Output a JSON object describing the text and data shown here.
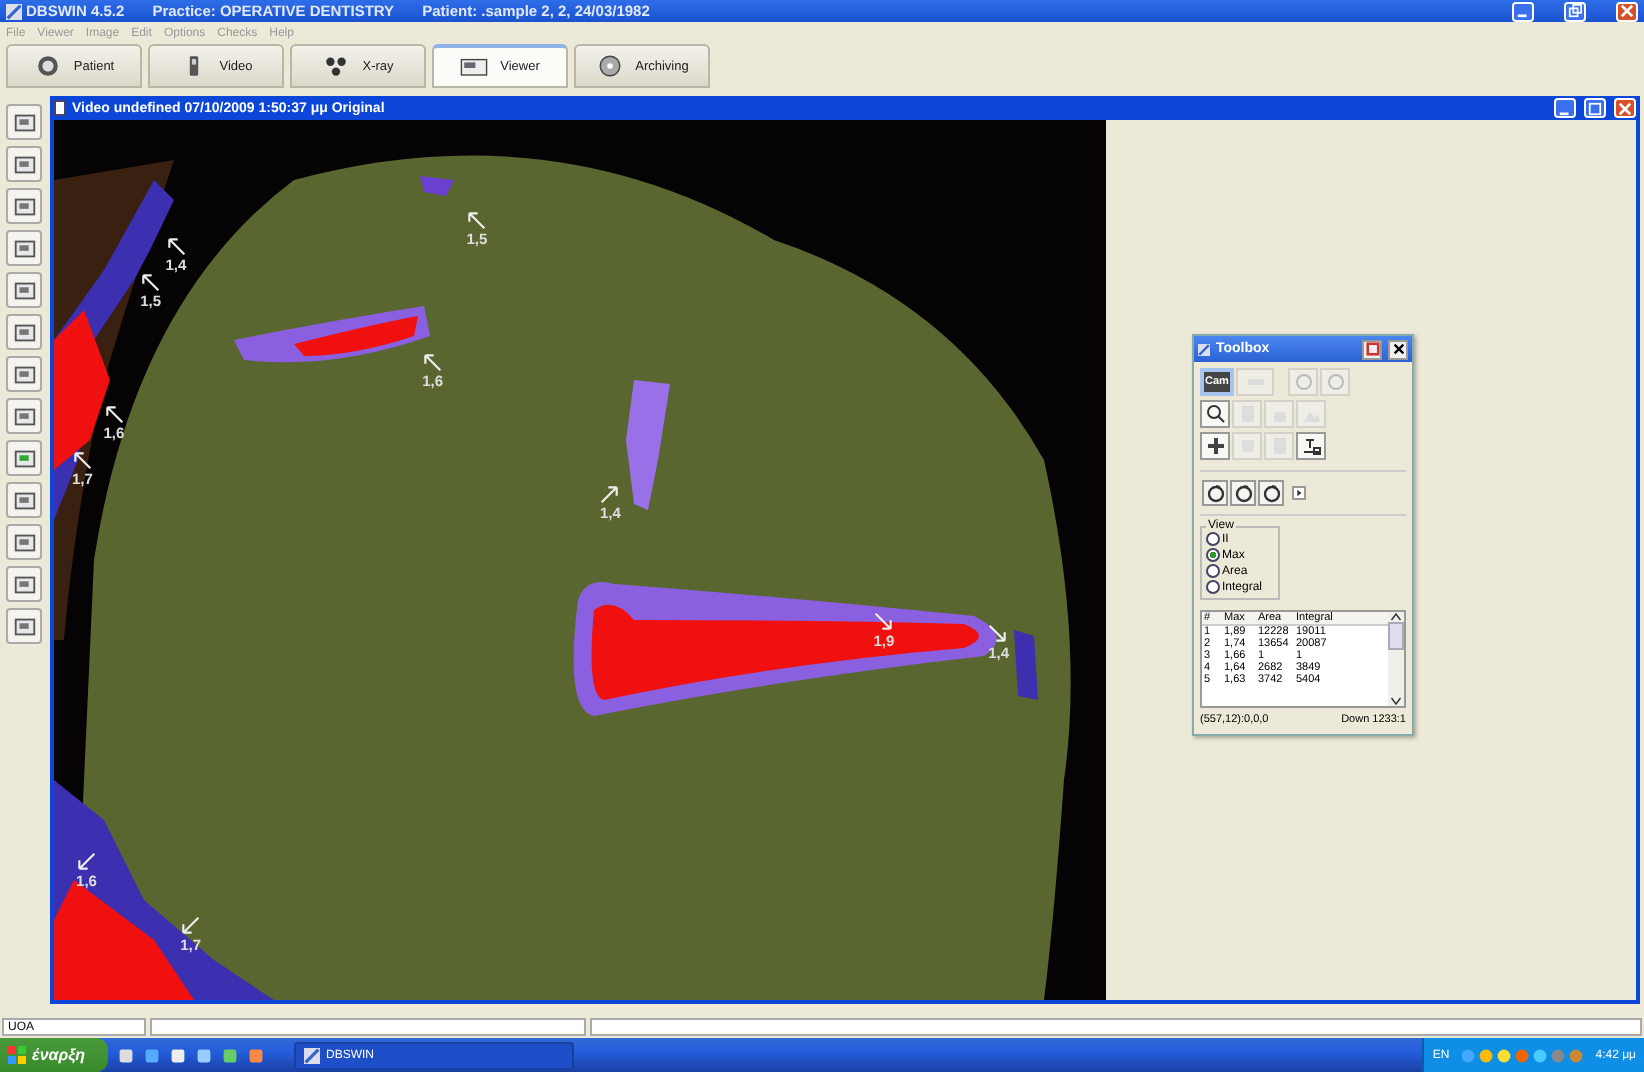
{
  "window": {
    "app": "DBSWIN 4.5.2",
    "practice": "Practice: OPERATIVE DENTISTRY",
    "patient": "Patient: .sample 2, 2, 24/03/1982"
  },
  "menu": [
    "File",
    "Viewer",
    "Image",
    "Edit",
    "Options",
    "Checks",
    "Help"
  ],
  "tabs": [
    {
      "label": "Patient",
      "kind": "patient",
      "selected": false
    },
    {
      "label": "Video",
      "kind": "video",
      "selected": false
    },
    {
      "label": "X-ray",
      "kind": "xray",
      "selected": false
    },
    {
      "label": "Viewer",
      "kind": "viewer",
      "selected": true
    },
    {
      "label": "Archiving",
      "kind": "archive",
      "selected": false
    }
  ],
  "video_window": {
    "title": "Video undefined 07/10/2009 1:50:37 μμ Original",
    "annotations": [
      {
        "label": "1,5"
      },
      {
        "label": "1,4"
      },
      {
        "label": "1,5"
      },
      {
        "label": "1,6"
      },
      {
        "label": "1,6"
      },
      {
        "label": "1,7"
      },
      {
        "label": "1,4"
      },
      {
        "label": "1,9"
      },
      {
        "label": "1,4"
      },
      {
        "label": "1,6"
      },
      {
        "label": "1,7"
      }
    ]
  },
  "toolbox": {
    "title": "Toolbox",
    "cam": {
      "label": "Cam",
      "selected": true
    },
    "view": {
      "legend": "View",
      "options": [
        {
          "label": "II",
          "selected": false
        },
        {
          "label": "Max",
          "selected": true
        },
        {
          "label": "Area",
          "selected": false
        },
        {
          "label": "Integral",
          "selected": false
        }
      ]
    },
    "table": {
      "columns": [
        "#",
        "Max",
        "Area",
        "Integral"
      ],
      "rows": [
        [
          "1",
          "1,89",
          "12228",
          "19011"
        ],
        [
          "2",
          "1,74",
          "13654",
          "20087"
        ],
        [
          "3",
          "1,66",
          "1",
          "1"
        ],
        [
          "4",
          "1,64",
          "2682",
          "3849"
        ],
        [
          "5",
          "1,63",
          "3742",
          "5404"
        ]
      ]
    },
    "status": [
      "(557,12):0,0,0",
      "Down 1233:1"
    ]
  },
  "status_bar": {
    "field": "UOA"
  },
  "taskbar": {
    "start": "έναρξη",
    "task": "DBSWIN",
    "language": "EN",
    "clock": "4:42 μμ"
  }
}
